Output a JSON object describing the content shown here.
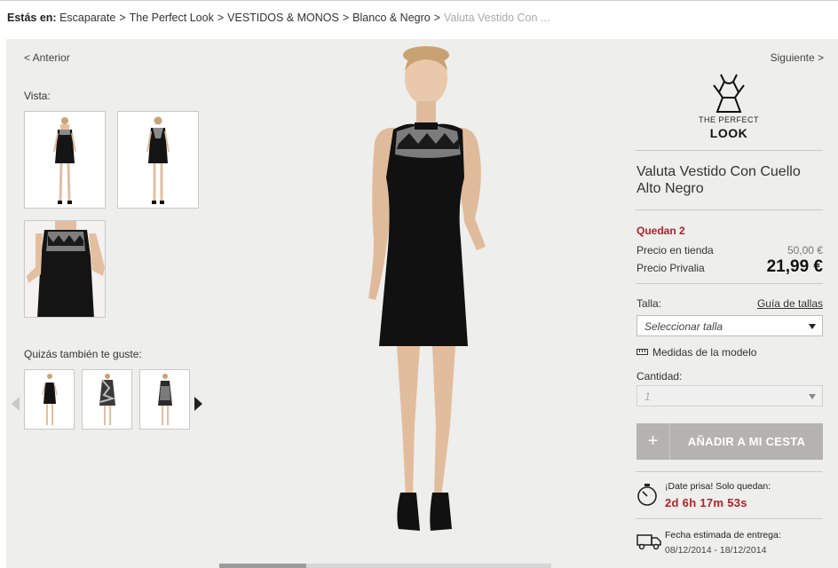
{
  "breadcrumb": {
    "prefix": "Estás en:",
    "items": [
      "Escaparate",
      "The Perfect Look",
      "VESTIDOS & MONOS",
      "Blanco & Negro"
    ],
    "separator": ">",
    "current": "Valuta Vestido Con ..."
  },
  "nav": {
    "prev": "< Anterior",
    "next": "Siguiente >"
  },
  "gallery": {
    "vista_label": "Vista:",
    "thumbnails": [
      "dress-front-view",
      "dress-back-view",
      "dress-detail-view"
    ]
  },
  "suggestions": {
    "label": "Quizás también te guste:",
    "items": [
      "black-strapless-dress",
      "printed-dress",
      "sequin-dress"
    ]
  },
  "brand": {
    "line1": "THE PERFECT",
    "line2": "LOOK"
  },
  "product": {
    "title": "Valuta Vestido Con Cuello Alto Negro",
    "stock": "Quedan 2",
    "store_price_label": "Precio en tienda",
    "store_price": "50,00 €",
    "privalia_price_label": "Precio Privalia",
    "privalia_price": "21,99 €"
  },
  "size": {
    "label": "Talla:",
    "guide_link": "Guía de tallas",
    "placeholder": "Seleccionar talla",
    "model_measures": "Medidas de la modelo"
  },
  "quantity": {
    "label": "Cantidad:",
    "value": "1"
  },
  "cart": {
    "icon": "+",
    "label": "AÑADIR A MI CESTA"
  },
  "countdown": {
    "text": "¡Date prisa! Solo quedan:",
    "value": "2d 6h 17m 53s"
  },
  "delivery": {
    "text": "Fecha estimada de entrega:",
    "dates": "08/12/2014 - 18/12/2014"
  },
  "colors": {
    "accent_red": "#b52025",
    "button_grey": "#b4b3b1",
    "stage_bg": "#eeeeec"
  }
}
